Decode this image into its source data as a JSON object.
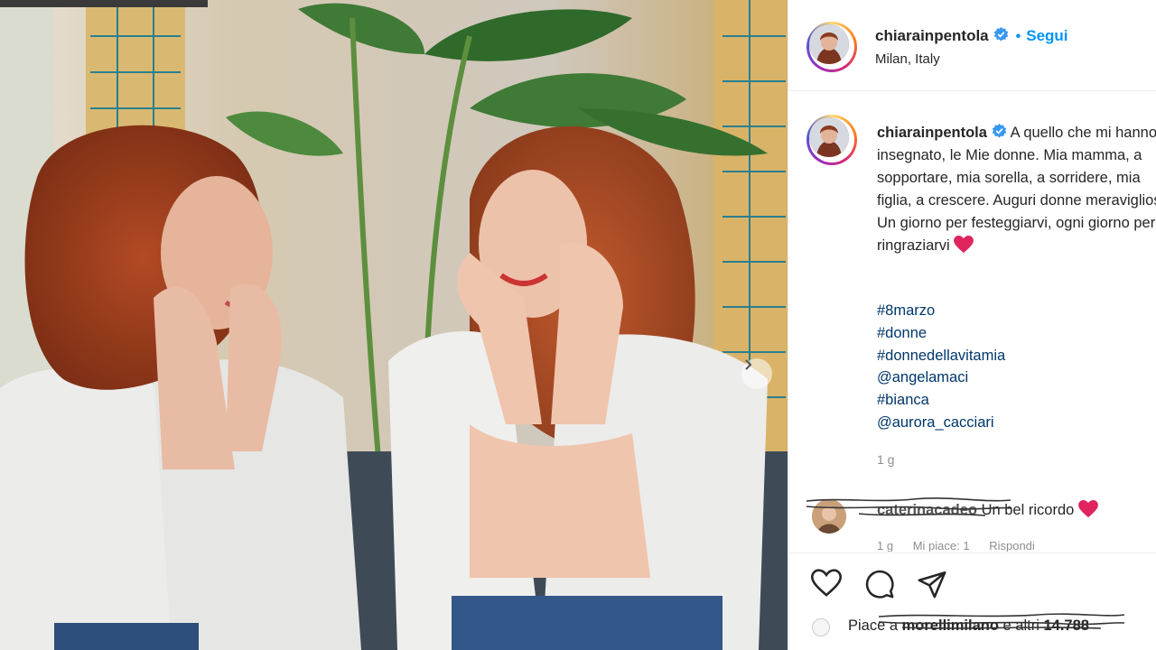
{
  "post": {
    "username": "chiarainpentola",
    "follow_label": "Segui",
    "separator": "•",
    "location": "Milan, Italy"
  },
  "caption": {
    "username": "chiarainpentola",
    "text": "A quello che mi hanno insegnato, le Mie donne. Mia mamma, a sopportare, mia sorella, a sorridere, mia figlia, a crescere. Auguri donne meravigliose. Un giorno per festeggiarvi, ogni giorno per ringraziarvi",
    "hashtags": [
      "#8marzo",
      "#donne",
      "#donnedellavitamia",
      "@angelamaci",
      "#bianca",
      "@aurora_cacciari"
    ],
    "time_ago": "1 g"
  },
  "comment": {
    "username": "caterinacadeo",
    "text": "Un bel ricordo",
    "time": "1 g",
    "likes": "Mi piace: 1",
    "reply": "Rispondi"
  },
  "likes": {
    "prefix": "Piace a",
    "user": "morellimilano",
    "suffix": "e altri",
    "count": "14.788"
  },
  "icons": {
    "like": "heart-icon",
    "comment": "comment-bubble-icon",
    "share": "paper-plane-icon",
    "verified": "verified-badge-icon",
    "next": "chevron-right-icon",
    "heart_emoji": "red-heart-emoji"
  },
  "colors": {
    "link_blue": "#0095f6",
    "hashtag_blue": "#00376b",
    "meta_gray": "#8e8e8e",
    "heart_red": "#e0245e"
  }
}
